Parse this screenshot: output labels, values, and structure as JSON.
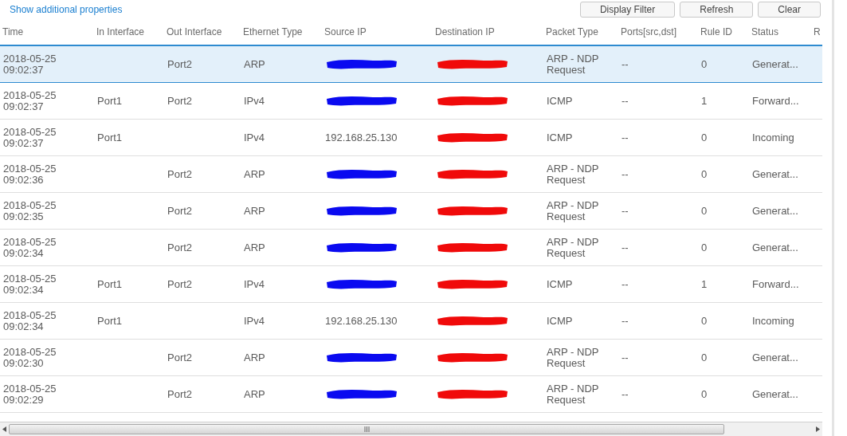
{
  "link": "Show additional properties",
  "buttons": [
    "Display Filter",
    "Refresh",
    "Clear"
  ],
  "table": {
    "columns": [
      "Time",
      "In Interface",
      "Out Interface",
      "Ethernet Type",
      "Source IP",
      "Destination IP",
      "Packet Type",
      "Ports[src,dst]",
      "Rule ID",
      "Status",
      "R"
    ],
    "rows": [
      {
        "selected": true,
        "cells": [
          "2018-05-25 09:02:37",
          "",
          "Port2",
          "ARP",
          {
            "redacted": true
          },
          {
            "redacted": true
          },
          "ARP - NDP Request",
          "--",
          "0",
          "Generat..."
        ]
      },
      {
        "selected": false,
        "cells": [
          "2018-05-25 09:02:37",
          "Port1",
          "Port2",
          "IPv4",
          {
            "redacted": true
          },
          {
            "redacted": true
          },
          "ICMP",
          "--",
          "1",
          "Forward..."
        ]
      },
      {
        "selected": false,
        "cells": [
          "2018-05-25 09:02:37",
          "Port1",
          "",
          "IPv4",
          "192.168.25.130",
          {
            "redacted": true
          },
          "ICMP",
          "--",
          "0",
          "Incoming"
        ]
      },
      {
        "selected": false,
        "cells": [
          "2018-05-25 09:02:36",
          "",
          "Port2",
          "ARP",
          {
            "redacted": true
          },
          {
            "redacted": true
          },
          "ARP - NDP Request",
          "--",
          "0",
          "Generat..."
        ]
      },
      {
        "selected": false,
        "cells": [
          "2018-05-25 09:02:35",
          "",
          "Port2",
          "ARP",
          {
            "redacted": true
          },
          {
            "redacted": true
          },
          "ARP - NDP Request",
          "--",
          "0",
          "Generat..."
        ]
      },
      {
        "selected": false,
        "cells": [
          "2018-05-25 09:02:34",
          "",
          "Port2",
          "ARP",
          {
            "redacted": true
          },
          {
            "redacted": true
          },
          "ARP - NDP Request",
          "--",
          "0",
          "Generat..."
        ]
      },
      {
        "selected": false,
        "cells": [
          "2018-05-25 09:02:34",
          "Port1",
          "Port2",
          "IPv4",
          {
            "redacted": true
          },
          {
            "redacted": true
          },
          "ICMP",
          "--",
          "1",
          "Forward..."
        ]
      },
      {
        "selected": false,
        "cells": [
          "2018-05-25 09:02:34",
          "Port1",
          "",
          "IPv4",
          "192.168.25.130",
          {
            "redacted": true
          },
          "ICMP",
          "--",
          "0",
          "Incoming"
        ]
      },
      {
        "selected": false,
        "cells": [
          "2018-05-25 09:02:30",
          "",
          "Port2",
          "ARP",
          {
            "redacted": true
          },
          {
            "redacted": true
          },
          "ARP - NDP Request",
          "--",
          "0",
          "Generat..."
        ]
      },
      {
        "selected": false,
        "cells": [
          "2018-05-25 09:02:29",
          "",
          "Port2",
          "ARP",
          {
            "redacted": true
          },
          {
            "redacted": true
          },
          "ARP - NDP Request",
          "--",
          "0",
          "Generat..."
        ]
      }
    ]
  }
}
